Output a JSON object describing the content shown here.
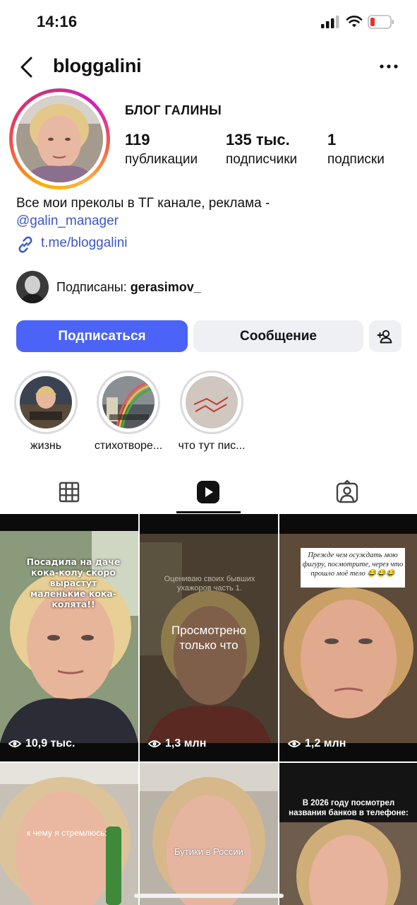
{
  "status_bar": {
    "time": "14:16"
  },
  "profile": {
    "username": "bloggalini",
    "display_name": "БЛОГ ГАЛИНЫ",
    "stats": [
      {
        "number": "119",
        "label": "публикации"
      },
      {
        "number": "135 тыс.",
        "label": "подписчики"
      },
      {
        "number": "1",
        "label": "подписки"
      }
    ],
    "bio_text": "Все мои преколы в ТГ канале, реклама -",
    "bio_mention": "@galin_manager",
    "link": "t.me/bloggalini",
    "followed_by_prefix": "Подписаны:",
    "followed_by_user": "gerasimov_"
  },
  "buttons": {
    "follow": "Подписаться",
    "message": "Сообщение"
  },
  "highlights": [
    {
      "label": "жизнь"
    },
    {
      "label": "стихотворе..."
    },
    {
      "label": "что тут пис..."
    }
  ],
  "tabs": [
    {
      "icon": "grid-icon",
      "active": false
    },
    {
      "icon": "reels-icon",
      "active": true
    },
    {
      "icon": "tagged-icon",
      "active": false
    }
  ],
  "reels": [
    {
      "caption": "Посадила на даче кока-колу скоро вырастут маленькие кока-колята!!",
      "views": "10,9 тыс."
    },
    {
      "caption": "Оцениваю своих бывших ухажоров часть 1.",
      "status": "Просмотрено только что",
      "views": "1,3 млн"
    },
    {
      "caption": "Прежде чем осуждать мою фигуру, посмотрите, через что прошло моё тело 😂😂😂",
      "views": "1,2 млн"
    },
    {
      "caption": "к чему я стремлюсь:"
    },
    {
      "caption": "Бутики в России"
    },
    {
      "caption": "В 2026 году посмотрел названия банков в телефоне:"
    }
  ],
  "colors": {
    "accent": "#4b63f7",
    "link": "#3d57c4",
    "secondary_button": "#eff0f3"
  }
}
